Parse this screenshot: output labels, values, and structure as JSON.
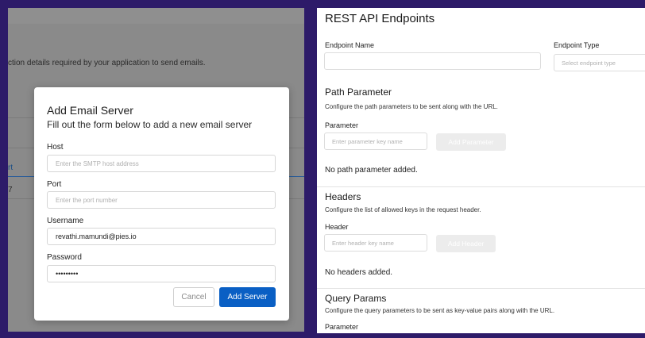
{
  "left": {
    "background_text": "ction details required by your application to send emails.",
    "background_col_header": "rt",
    "background_cell": "7",
    "modal": {
      "title": "Add Email Server",
      "subtitle": "Fill out the form below to add a new email server",
      "fields": [
        {
          "label": "Host",
          "placeholder": "Enter the SMTP host address",
          "value": ""
        },
        {
          "label": "Port",
          "placeholder": "Enter the port number",
          "value": ""
        },
        {
          "label": "Username",
          "placeholder": "",
          "value": "revathi.mamundi@pies.io"
        },
        {
          "label": "Password",
          "placeholder": "",
          "value": "•••••••••"
        }
      ],
      "cancel_label": "Cancel",
      "submit_label": "Add Server"
    }
  },
  "right": {
    "title": "REST API Endpoints",
    "endpoint_name_label": "Endpoint Name",
    "endpoint_name_value": "",
    "endpoint_type_label": "Endpoint Type",
    "endpoint_type_placeholder": "Select endpoint type",
    "path": {
      "title": "Path Parameter",
      "description": "Configure the path parameters to be sent along with the URL.",
      "field_label": "Parameter",
      "placeholder": "Enter parameter key name",
      "button_label": "Add Parameter",
      "empty_text": "No path parameter added."
    },
    "headers": {
      "title": "Headers",
      "description": "Configure the list of allowed keys in the request header.",
      "field_label": "Header",
      "placeholder": "Enter header key name",
      "button_label": "Add Header",
      "empty_text": "No headers added."
    },
    "query": {
      "title": "Query Params",
      "description": "Configure the query parameters to be sent as key-value pairs along with the URL.",
      "field_label": "Parameter"
    }
  },
  "colors": {
    "frame": "#2d1b69",
    "primary_button": "#0a5fc4",
    "overlay_gray": "#8a8a8a"
  }
}
